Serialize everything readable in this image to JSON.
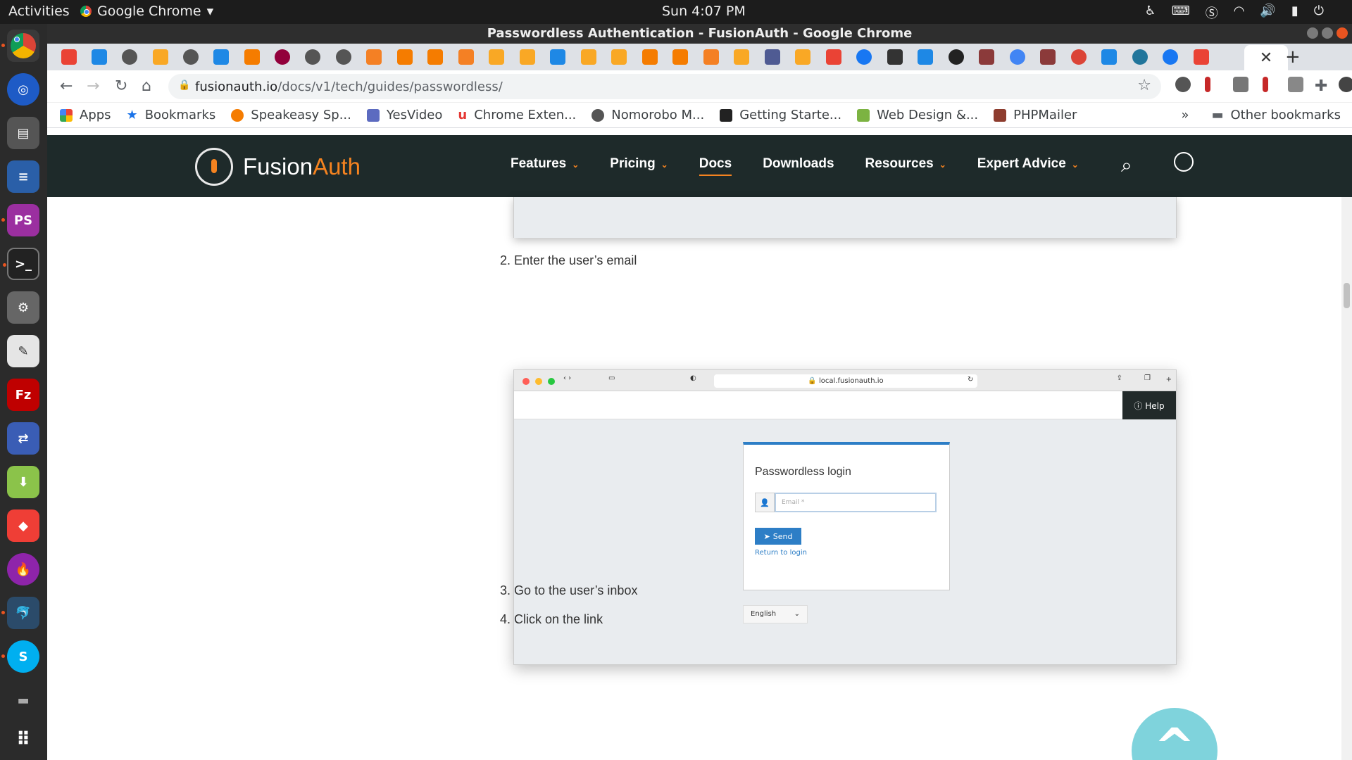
{
  "system": {
    "activities": "Activities",
    "app_name": "Google Chrome",
    "clock": "Sun  4:07 PM"
  },
  "window": {
    "title": "Passwordless Authentication - FusionAuth - Google Chrome",
    "active_tab_close": "✕",
    "new_tab": "+"
  },
  "toolbar": {
    "url_host": "fusionauth.io",
    "url_path": "/docs/v1/tech/guides/passwordless/"
  },
  "bookmarks": {
    "items": [
      {
        "label": "Apps",
        "color": "#ea4335"
      },
      {
        "label": "Bookmarks",
        "color": "#1a73e8"
      },
      {
        "label": "Speakeasy Sp...",
        "color": "#f57c00"
      },
      {
        "label": "YesVideo",
        "color": "#5c6bc0"
      },
      {
        "label": "Chrome Exten...",
        "color": "#e53935"
      },
      {
        "label": "Nomorobo M...",
        "color": "#555555"
      },
      {
        "label": "Getting Starte...",
        "color": "#222222"
      },
      {
        "label": "Web Design &...",
        "color": "#7cb342"
      },
      {
        "label": "PHPMailer",
        "color": "#8d3c2e"
      }
    ],
    "overflow": "»",
    "other": "Other bookmarks"
  },
  "site": {
    "brand_fusion": "Fusion",
    "brand_auth": "Auth",
    "menu": [
      {
        "label": "Features",
        "caret": "⌄"
      },
      {
        "label": "Pricing",
        "caret": "⌄"
      },
      {
        "label": "Docs",
        "caret": ""
      },
      {
        "label": "Downloads",
        "caret": ""
      },
      {
        "label": "Resources",
        "caret": "⌄"
      },
      {
        "label": "Expert Advice",
        "caret": "⌄"
      }
    ]
  },
  "content": {
    "step2": "2. Enter the user’s email",
    "step3": "3. Go to the user’s inbox",
    "step4": "4. Click on the link"
  },
  "screenshot": {
    "url": "🔒 local.fusionauth.io",
    "help": "ⓘ Help",
    "panel_title": "Passwordless login",
    "email_placeholder": "Email *",
    "send": "Send",
    "return_link": "Return to login",
    "language": "English"
  },
  "colors": {
    "brand_orange": "#f58320",
    "nav_bg": "#1e2a2a",
    "link_blue": "#2d7ec6",
    "scroll_top": "#7fd3dc"
  }
}
